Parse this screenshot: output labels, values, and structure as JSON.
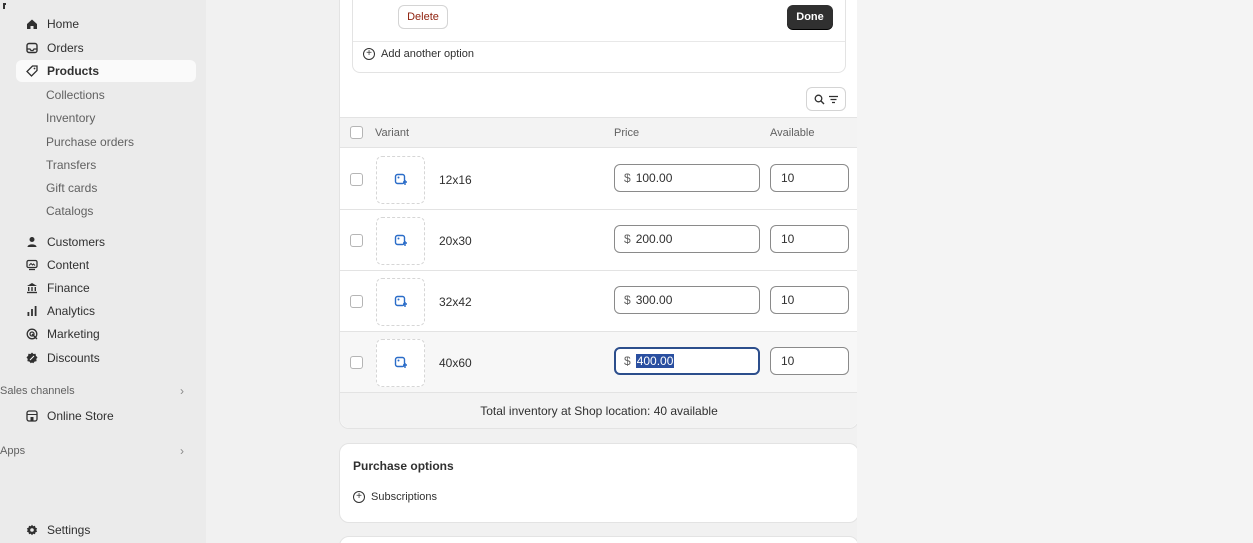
{
  "sidebar": {
    "main_items": [
      {
        "label": "Home",
        "icon": "home-icon"
      },
      {
        "label": "Orders",
        "icon": "inbox-icon"
      },
      {
        "label": "Products",
        "icon": "tag-icon"
      }
    ],
    "product_sub_items": [
      "Collections",
      "Inventory",
      "Purchase orders",
      "Transfers",
      "Gift cards",
      "Catalogs"
    ],
    "more_items": [
      {
        "label": "Customers",
        "icon": "person-icon"
      },
      {
        "label": "Content",
        "icon": "content-icon"
      },
      {
        "label": "Finance",
        "icon": "bank-icon"
      },
      {
        "label": "Analytics",
        "icon": "bar-chart-icon"
      },
      {
        "label": "Marketing",
        "icon": "target-icon"
      },
      {
        "label": "Discounts",
        "icon": "discount-icon"
      }
    ],
    "sales_channels_label": "Sales channels",
    "online_store_label": "Online Store",
    "apps_label": "Apps",
    "settings_label": "Settings"
  },
  "options_editor": {
    "delete_label": "Delete",
    "done_label": "Done",
    "add_option_label": "Add another option"
  },
  "variants_table": {
    "headers": {
      "variant": "Variant",
      "price": "Price",
      "available": "Available"
    },
    "currency": "$",
    "rows": [
      {
        "name": "12x16",
        "price": "100.00",
        "available": "10"
      },
      {
        "name": "20x30",
        "price": "200.00",
        "available": "10"
      },
      {
        "name": "32x42",
        "price": "300.00",
        "available": "10"
      },
      {
        "name": "40x60",
        "price": "400.00",
        "available": "10"
      }
    ],
    "total_text": "Total inventory at Shop location: 40 available"
  },
  "purchase_options": {
    "title": "Purchase options",
    "subscriptions_label": "Subscriptions"
  },
  "colors": {
    "accent": "#2a4fa0",
    "danger": "#8e1f0b",
    "primary_button": "#303030"
  }
}
